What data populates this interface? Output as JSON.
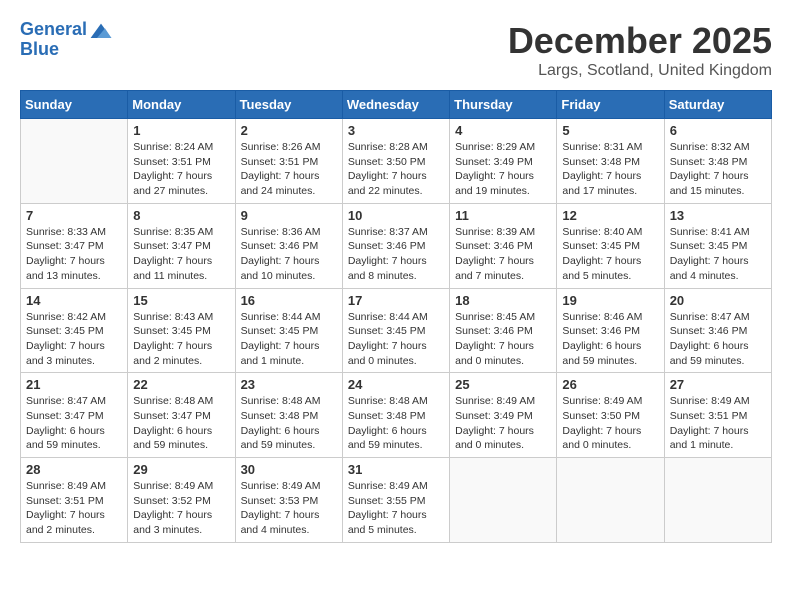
{
  "logo": {
    "line1": "General",
    "line2": "Blue"
  },
  "title": "December 2025",
  "location": "Largs, Scotland, United Kingdom",
  "weekdays": [
    "Sunday",
    "Monday",
    "Tuesday",
    "Wednesday",
    "Thursday",
    "Friday",
    "Saturday"
  ],
  "weeks": [
    [
      {
        "day": "",
        "info": ""
      },
      {
        "day": "1",
        "info": "Sunrise: 8:24 AM\nSunset: 3:51 PM\nDaylight: 7 hours\nand 27 minutes."
      },
      {
        "day": "2",
        "info": "Sunrise: 8:26 AM\nSunset: 3:51 PM\nDaylight: 7 hours\nand 24 minutes."
      },
      {
        "day": "3",
        "info": "Sunrise: 8:28 AM\nSunset: 3:50 PM\nDaylight: 7 hours\nand 22 minutes."
      },
      {
        "day": "4",
        "info": "Sunrise: 8:29 AM\nSunset: 3:49 PM\nDaylight: 7 hours\nand 19 minutes."
      },
      {
        "day": "5",
        "info": "Sunrise: 8:31 AM\nSunset: 3:48 PM\nDaylight: 7 hours\nand 17 minutes."
      },
      {
        "day": "6",
        "info": "Sunrise: 8:32 AM\nSunset: 3:48 PM\nDaylight: 7 hours\nand 15 minutes."
      }
    ],
    [
      {
        "day": "7",
        "info": "Sunrise: 8:33 AM\nSunset: 3:47 PM\nDaylight: 7 hours\nand 13 minutes."
      },
      {
        "day": "8",
        "info": "Sunrise: 8:35 AM\nSunset: 3:47 PM\nDaylight: 7 hours\nand 11 minutes."
      },
      {
        "day": "9",
        "info": "Sunrise: 8:36 AM\nSunset: 3:46 PM\nDaylight: 7 hours\nand 10 minutes."
      },
      {
        "day": "10",
        "info": "Sunrise: 8:37 AM\nSunset: 3:46 PM\nDaylight: 7 hours\nand 8 minutes."
      },
      {
        "day": "11",
        "info": "Sunrise: 8:39 AM\nSunset: 3:46 PM\nDaylight: 7 hours\nand 7 minutes."
      },
      {
        "day": "12",
        "info": "Sunrise: 8:40 AM\nSunset: 3:45 PM\nDaylight: 7 hours\nand 5 minutes."
      },
      {
        "day": "13",
        "info": "Sunrise: 8:41 AM\nSunset: 3:45 PM\nDaylight: 7 hours\nand 4 minutes."
      }
    ],
    [
      {
        "day": "14",
        "info": "Sunrise: 8:42 AM\nSunset: 3:45 PM\nDaylight: 7 hours\nand 3 minutes."
      },
      {
        "day": "15",
        "info": "Sunrise: 8:43 AM\nSunset: 3:45 PM\nDaylight: 7 hours\nand 2 minutes."
      },
      {
        "day": "16",
        "info": "Sunrise: 8:44 AM\nSunset: 3:45 PM\nDaylight: 7 hours\nand 1 minute."
      },
      {
        "day": "17",
        "info": "Sunrise: 8:44 AM\nSunset: 3:45 PM\nDaylight: 7 hours\nand 0 minutes."
      },
      {
        "day": "18",
        "info": "Sunrise: 8:45 AM\nSunset: 3:46 PM\nDaylight: 7 hours\nand 0 minutes."
      },
      {
        "day": "19",
        "info": "Sunrise: 8:46 AM\nSunset: 3:46 PM\nDaylight: 6 hours\nand 59 minutes."
      },
      {
        "day": "20",
        "info": "Sunrise: 8:47 AM\nSunset: 3:46 PM\nDaylight: 6 hours\nand 59 minutes."
      }
    ],
    [
      {
        "day": "21",
        "info": "Sunrise: 8:47 AM\nSunset: 3:47 PM\nDaylight: 6 hours\nand 59 minutes."
      },
      {
        "day": "22",
        "info": "Sunrise: 8:48 AM\nSunset: 3:47 PM\nDaylight: 6 hours\nand 59 minutes."
      },
      {
        "day": "23",
        "info": "Sunrise: 8:48 AM\nSunset: 3:48 PM\nDaylight: 6 hours\nand 59 minutes."
      },
      {
        "day": "24",
        "info": "Sunrise: 8:48 AM\nSunset: 3:48 PM\nDaylight: 6 hours\nand 59 minutes."
      },
      {
        "day": "25",
        "info": "Sunrise: 8:49 AM\nSunset: 3:49 PM\nDaylight: 7 hours\nand 0 minutes."
      },
      {
        "day": "26",
        "info": "Sunrise: 8:49 AM\nSunset: 3:50 PM\nDaylight: 7 hours\nand 0 minutes."
      },
      {
        "day": "27",
        "info": "Sunrise: 8:49 AM\nSunset: 3:51 PM\nDaylight: 7 hours\nand 1 minute."
      }
    ],
    [
      {
        "day": "28",
        "info": "Sunrise: 8:49 AM\nSunset: 3:51 PM\nDaylight: 7 hours\nand 2 minutes."
      },
      {
        "day": "29",
        "info": "Sunrise: 8:49 AM\nSunset: 3:52 PM\nDaylight: 7 hours\nand 3 minutes."
      },
      {
        "day": "30",
        "info": "Sunrise: 8:49 AM\nSunset: 3:53 PM\nDaylight: 7 hours\nand 4 minutes."
      },
      {
        "day": "31",
        "info": "Sunrise: 8:49 AM\nSunset: 3:55 PM\nDaylight: 7 hours\nand 5 minutes."
      },
      {
        "day": "",
        "info": ""
      },
      {
        "day": "",
        "info": ""
      },
      {
        "day": "",
        "info": ""
      }
    ]
  ]
}
